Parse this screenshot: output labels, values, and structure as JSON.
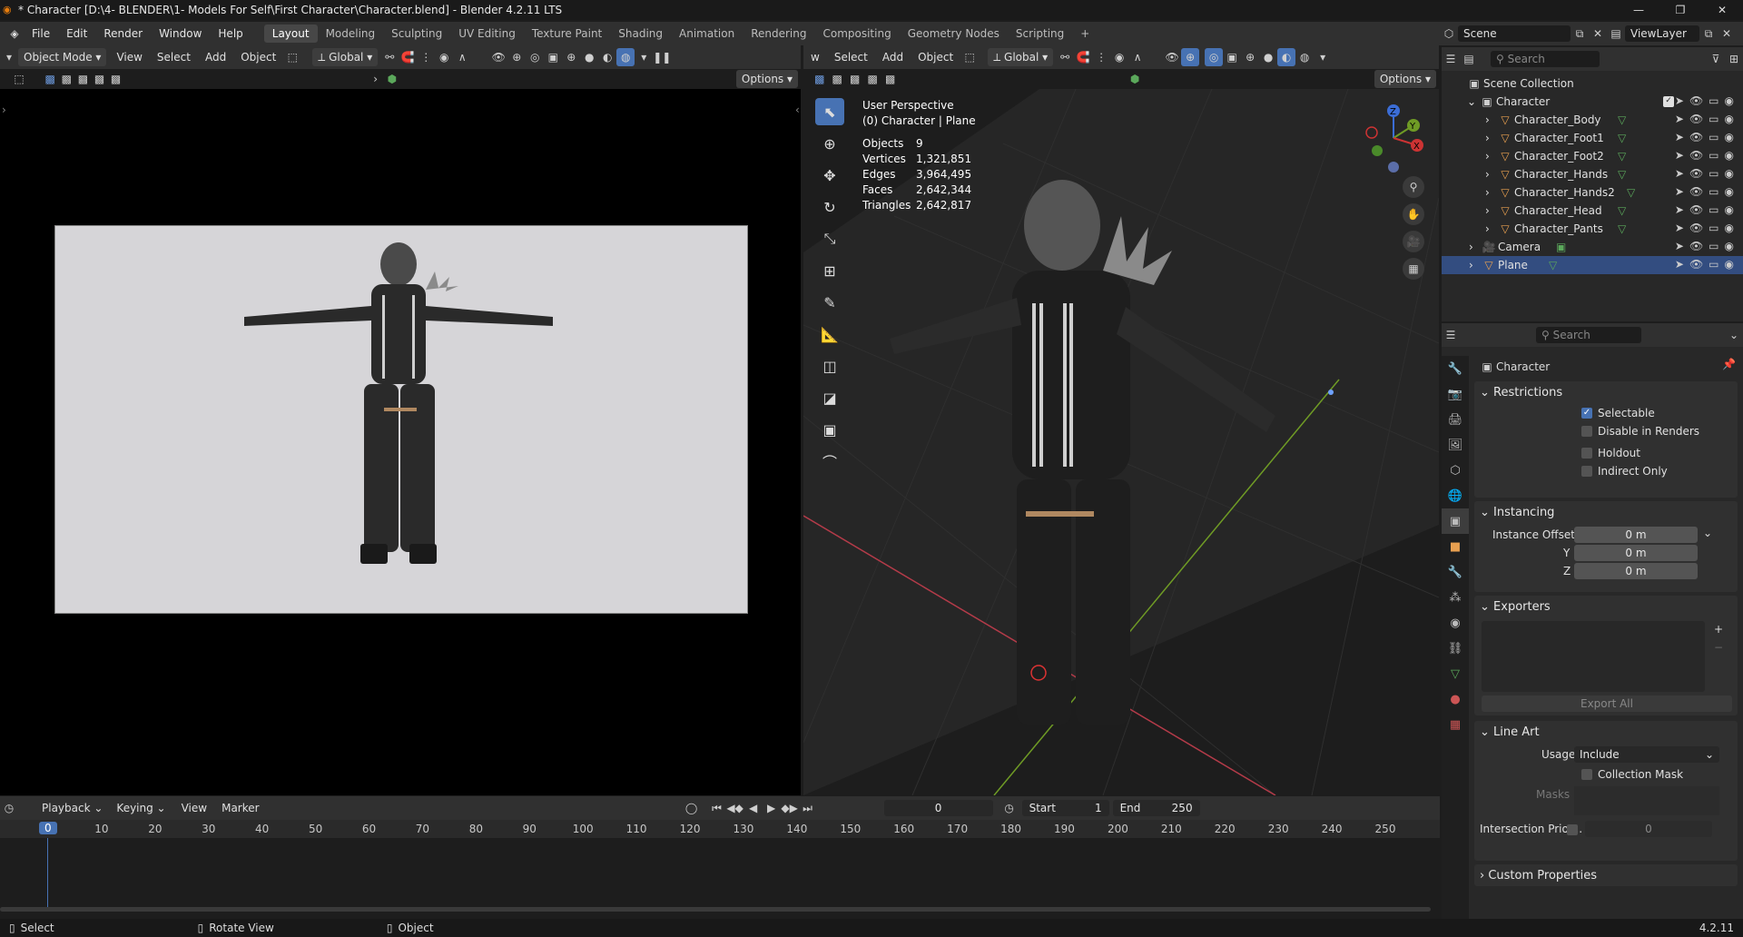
{
  "titlebar": {
    "title": "* Character [D:\\4- BLENDER\\1- Models For Self\\First Character\\Character.blend] - Blender 4.2.11 LTS",
    "min": "—",
    "max": "❐",
    "close": "✕"
  },
  "menu": {
    "items": [
      "File",
      "Edit",
      "Render",
      "Window",
      "Help"
    ]
  },
  "workspaces": {
    "tabs": [
      "Layout",
      "Modeling",
      "Sculpting",
      "UV Editing",
      "Texture Paint",
      "Shading",
      "Animation",
      "Rendering",
      "Compositing",
      "Geometry Nodes",
      "Scripting"
    ],
    "active": "Layout",
    "add": "+"
  },
  "scene": {
    "label": "Scene",
    "viewlayer": "ViewLayer"
  },
  "left_header": {
    "mode": "Object Mode",
    "view": "View",
    "select": "Select",
    "add": "Add",
    "object": "Object",
    "orientation": "Global",
    "options": "Options"
  },
  "right_header": {
    "view_trunc": "w",
    "select": "Select",
    "add": "Add",
    "object": "Object",
    "orientation": "Global",
    "options": "Options"
  },
  "viewport_info": {
    "perspective": "User Perspective",
    "context": "(0) Character | Plane",
    "stats": [
      {
        "label": "Objects",
        "value": "9"
      },
      {
        "label": "Vertices",
        "value": "1,321,851"
      },
      {
        "label": "Edges",
        "value": "3,964,495"
      },
      {
        "label": "Faces",
        "value": "2,642,344"
      },
      {
        "label": "Triangles",
        "value": "2,642,817"
      }
    ]
  },
  "gizmo": {
    "x": "X",
    "y": "Y",
    "z": "Z"
  },
  "outliner": {
    "search_placeholder": "Search",
    "root": "Scene Collection",
    "collection": "Character",
    "meshes": [
      "Character_Body",
      "Character_Foot1",
      "Character_Foot2",
      "Character_Hands",
      "Character_Hands2",
      "Character_Head",
      "Character_Pants"
    ],
    "camera": "Camera",
    "plane": "Plane"
  },
  "properties": {
    "search_placeholder": "Search",
    "context": "Character",
    "restrictions": {
      "title": "Restrictions",
      "selectable": "Selectable",
      "disable_renders": "Disable in Renders",
      "holdout": "Holdout",
      "indirect_only": "Indirect Only"
    },
    "instancing": {
      "title": "Instancing",
      "offset_x_label": "Instance Offset X",
      "y_label": "Y",
      "z_label": "Z",
      "x": "0 m",
      "y": "0 m",
      "z": "0 m"
    },
    "exporters": {
      "title": "Exporters",
      "export_all": "Export All",
      "add": "+",
      "remove": "−"
    },
    "line_art": {
      "title": "Line Art",
      "usage_label": "Usage",
      "usage": "Include",
      "collection_mask": "Collection Mask",
      "masks": "Masks",
      "intersection_label": "Intersection Prior...",
      "intersection_value": "0"
    },
    "custom": {
      "title": "Custom Properties"
    }
  },
  "timeline": {
    "playback": "Playback",
    "keying": "Keying",
    "view": "View",
    "marker": "Marker",
    "current_frame": "0",
    "start_label": "Start",
    "start": "1",
    "end_label": "End",
    "end": "250",
    "ticks": [
      "0",
      "10",
      "20",
      "30",
      "40",
      "50",
      "60",
      "70",
      "80",
      "90",
      "100",
      "110",
      "120",
      "130",
      "140",
      "150",
      "160",
      "170",
      "180",
      "190",
      "200",
      "210",
      "220",
      "230",
      "240",
      "250"
    ],
    "playhead": "0"
  },
  "statusbar": {
    "select": "Select",
    "rotate": "Rotate View",
    "object": "Object",
    "version": "4.2.11"
  }
}
